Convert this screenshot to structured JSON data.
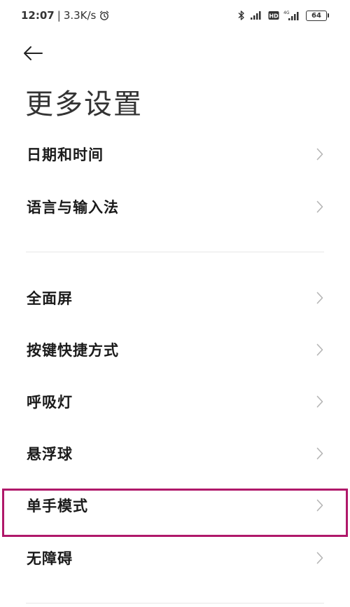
{
  "status_bar": {
    "time": "12:07",
    "separator": "|",
    "net_speed": "3.3K/s",
    "battery": "64",
    "hd_label": "HD",
    "network_label": "4G"
  },
  "header": {
    "title": "更多设置"
  },
  "settings": {
    "items": [
      {
        "label": "日期和时间"
      },
      {
        "label": "语言与输入法"
      },
      {
        "label": "全面屏"
      },
      {
        "label": "按键快捷方式"
      },
      {
        "label": "呼吸灯"
      },
      {
        "label": "悬浮球"
      },
      {
        "label": "单手模式"
      },
      {
        "label": "无障碍"
      }
    ]
  },
  "colors": {
    "highlight": "#b0186a",
    "chevron": "#b5b5b5"
  }
}
